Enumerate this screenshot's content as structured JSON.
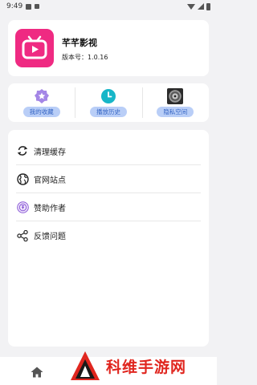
{
  "status_bar": {
    "time": "9:49"
  },
  "app": {
    "name": "芊芊影视",
    "version": "版本号：1.0.16"
  },
  "shortcuts": [
    {
      "label": "我的收藏",
      "icon": "star-badge-icon"
    },
    {
      "label": "播放历史",
      "icon": "clock-icon"
    },
    {
      "label": "隐私空间",
      "icon": "vinyl-disc-icon"
    }
  ],
  "menu": [
    {
      "label": "清理缓存",
      "icon": "refresh-icon"
    },
    {
      "label": "官网站点",
      "icon": "globe-icon"
    },
    {
      "label": "赞助作者",
      "icon": "sponsor-icon"
    },
    {
      "label": "反馈问题",
      "icon": "share-icon"
    }
  ],
  "bottom_nav": {
    "home_icon": "home-icon"
  },
  "watermark": {
    "text": "科维手游网"
  },
  "colors": {
    "brand": "#ef2a82",
    "pill_bg": "#b9cef7",
    "pill_text": "#3565c4",
    "watermark": "#e0261f"
  }
}
